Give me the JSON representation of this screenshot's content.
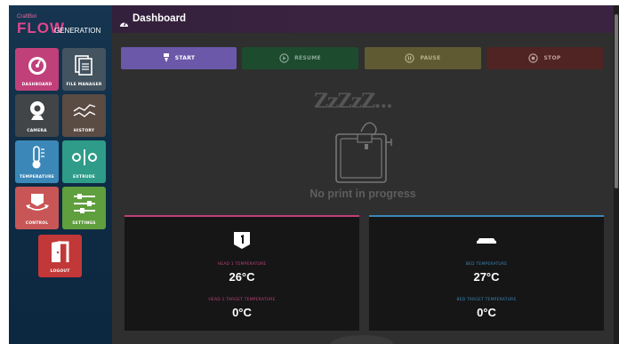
{
  "brand": {
    "top_text": "CraftBot",
    "flow_text": "FLOW",
    "generation_text": "GENERATION"
  },
  "sidebar": {
    "tiles": [
      {
        "label": "DASHBOARD",
        "icon": "gauge-icon",
        "color": "#c0407a"
      },
      {
        "label": "FILE MANAGER",
        "icon": "files-icon",
        "color": "#43535f"
      },
      {
        "label": "CAMERA",
        "icon": "webcam-icon",
        "color": "#414548"
      },
      {
        "label": "HISTORY",
        "icon": "chart-line-icon",
        "color": "#5a4b43"
      },
      {
        "label": "TEMPERATURE",
        "icon": "thermometer-icon",
        "color": "#3b88b8"
      },
      {
        "label": "EXTRUDE",
        "icon": "extrude-icon",
        "color": "#2e9c88"
      },
      {
        "label": "CONTROL",
        "icon": "move-arrows-icon",
        "color": "#c95656"
      },
      {
        "label": "SETTINGS",
        "icon": "sliders-icon",
        "color": "#5f9f3d"
      },
      {
        "label": "LOGOUT",
        "icon": "door-exit-icon",
        "color": "#c23838"
      }
    ]
  },
  "header": {
    "title": "Dashboard",
    "icon": "gauge-icon"
  },
  "controls": {
    "start": "START",
    "resume": "RESUME",
    "pause": "PAUSE",
    "stop": "STOP"
  },
  "status": {
    "sleep_text": "ZzZzZ...",
    "message": "No print in progress"
  },
  "head_panel": {
    "icon": "head-number-1-icon",
    "temp_label": "HEAD 1 TEMPERATURE",
    "temp_value": "26°C",
    "target_label": "HEAD 1 TARGET TEMPERATURE",
    "target_value": "0°C",
    "accent": "#c0407a"
  },
  "bed_panel": {
    "icon": "bed-icon",
    "temp_label": "BED TEMPERATURE",
    "temp_value": "27°C",
    "target_label": "BED TARGET TEMPERATURE",
    "target_value": "0°C",
    "accent": "#3b88b8"
  }
}
